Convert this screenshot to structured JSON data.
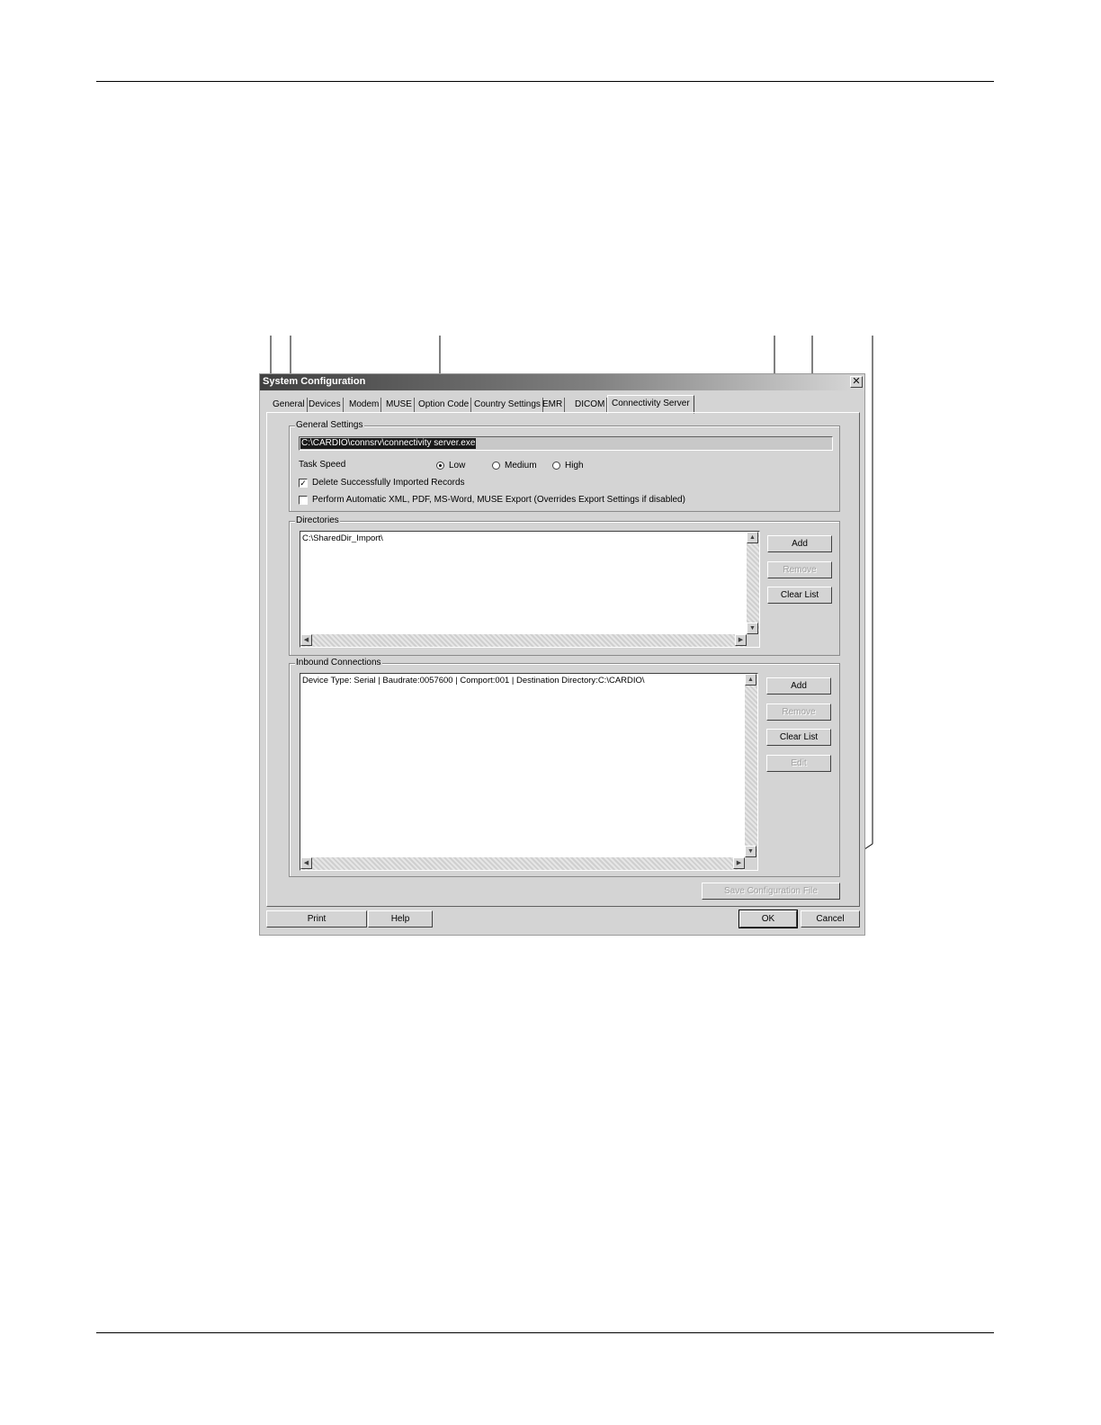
{
  "window": {
    "title": "System Configuration",
    "close_glyph": "✕"
  },
  "tabs": [
    {
      "label": "General"
    },
    {
      "label": "Devices"
    },
    {
      "label": "Modem"
    },
    {
      "label": "MUSE"
    },
    {
      "label": "Option Code"
    },
    {
      "label": "Country Settings"
    },
    {
      "label": "EMR"
    },
    {
      "label": "DICOM"
    },
    {
      "label": "Connectivity Server",
      "active": true
    }
  ],
  "general_settings": {
    "legend": "General Settings",
    "path": "C:\\CARDIO\\connsrv\\connectivity server.exe",
    "task_speed_label": "Task Speed",
    "speed_options": [
      "Low",
      "Medium",
      "High"
    ],
    "selected_speed": "Low",
    "delete_label": "Delete Successfully Imported Records",
    "delete_checked": true,
    "export_label": "Perform Automatic XML, PDF, MS-Word, MUSE Export (Overrides Export Settings if disabled)",
    "export_checked": false
  },
  "directories": {
    "legend": "Directories",
    "items": [
      "C:\\SharedDir_Import\\"
    ],
    "add": "Add",
    "remove": "Remove",
    "clear": "Clear List"
  },
  "inbound": {
    "legend": "Inbound Connections",
    "items": [
      "Device Type: Serial  |  Baudrate:0057600  |  Comport:001  |  Destination Directory:C:\\CARDIO\\"
    ],
    "add": "Add",
    "remove": "Remove",
    "clear": "Clear List",
    "edit": "Edit"
  },
  "save_config": "Save Configuration File",
  "footer": {
    "print": "Print",
    "help": "Help",
    "ok": "OK",
    "cancel": "Cancel"
  },
  "icons": {
    "scroll_up": "▲",
    "scroll_down": "▼",
    "scroll_left": "◀",
    "scroll_right": "▶",
    "check_mark": "✓"
  }
}
